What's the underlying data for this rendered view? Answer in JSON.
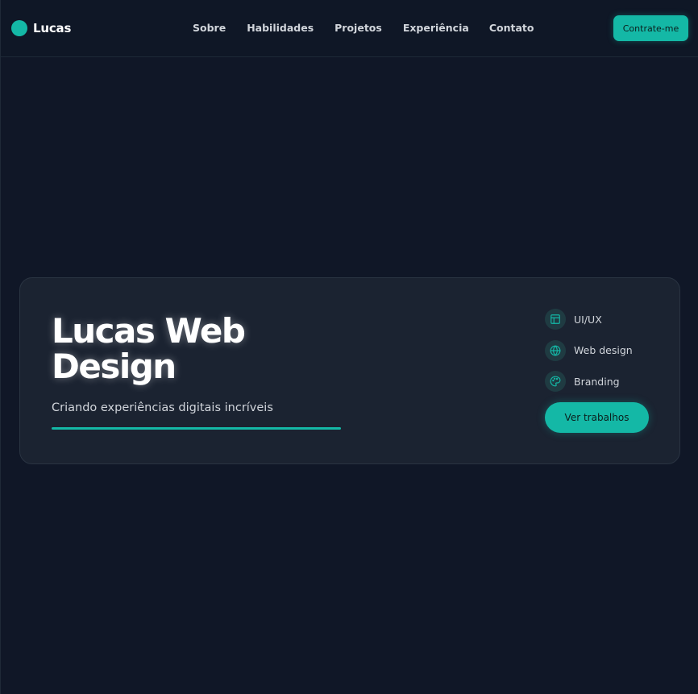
{
  "header": {
    "logo_text": "Lucas",
    "nav": [
      "Sobre",
      "Habilidades",
      "Projetos",
      "Experiência",
      "Contato"
    ],
    "cta_label": "Contrate-me"
  },
  "hero": {
    "title": "Lucas Web Design",
    "subtitle": "Criando experiências digitais incríveis",
    "skills": [
      {
        "label": "UI/UX",
        "icon": "layout-icon"
      },
      {
        "label": "Web design",
        "icon": "globe-icon"
      },
      {
        "label": "Branding",
        "icon": "palette-icon"
      }
    ],
    "button_label": "Ver trabalhos"
  },
  "colors": {
    "accent": "#14b8a6",
    "background": "#101727",
    "card": "#1b2331"
  }
}
